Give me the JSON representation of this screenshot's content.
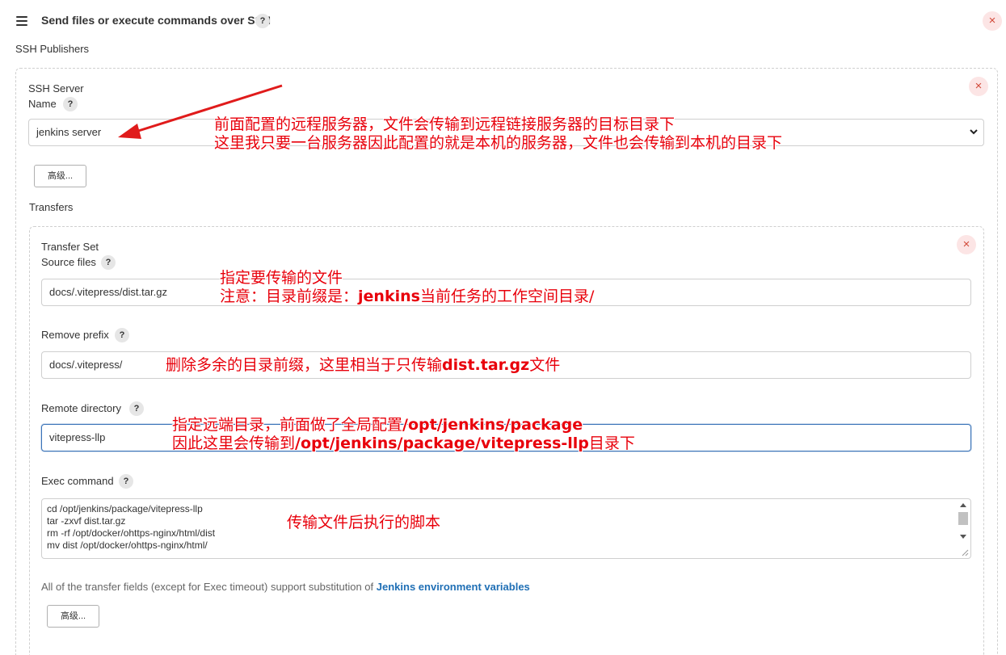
{
  "header": {
    "title": "Send files or execute commands over SSH",
    "help": "?",
    "close": "×",
    "publishers_label": "SSH Publishers"
  },
  "server": {
    "heading": "SSH Server",
    "name_label": "Name",
    "help": "?",
    "close": "×",
    "name_value": "jenkins server",
    "advanced_button": "高级...",
    "transfers_label": "Transfers"
  },
  "transfer_set": {
    "heading": "Transfer Set",
    "close": "×",
    "source_files": {
      "label": "Source files",
      "help": "?",
      "value": "docs/.vitepress/dist.tar.gz"
    },
    "remove_prefix": {
      "label": "Remove prefix",
      "help": "?",
      "value": "docs/.vitepress/"
    },
    "remote_directory": {
      "label": "Remote directory",
      "help": "?",
      "value": "vitepress-llp"
    },
    "exec_command": {
      "label": "Exec command",
      "help": "?",
      "lines": [
        "cd /opt/jenkins/package/vitepress-llp",
        "tar -zxvf dist.tar.gz",
        "rm -rf /opt/docker/ohttps-nginx/html/dist",
        "mv dist /opt/docker/ohttps-nginx/html/"
      ]
    },
    "note_text": "All of the transfer fields (except for Exec timeout) support substitution of",
    "note_link": "Jenkins environment variables",
    "advanced_button": "高级..."
  },
  "annotations": {
    "server_line1": "前面配置的远程服务器，文件会传输到远程链接服务器的目标目录下",
    "server_line2": "这里我只要一台服务器因此配置的就是本机的服务器，文件也会传输到本机的目录下",
    "source_line1": "指定要传输的文件",
    "source_line2a": "注意：目录前缀是：",
    "source_line2b": "jenkins",
    "source_line2c": "当前任务的工作空间目录/",
    "prefix_a": "删除多余的目录前缀，这里相当于只传输",
    "prefix_b": "dist.tar.gz",
    "prefix_c": "文件",
    "remote_line1a": "指定远端目录，前面做了全局配置",
    "remote_line1b": "/opt/jenkins/package",
    "remote_line2a": "因此这里会传输到",
    "remote_line2b": "/opt/jenkins/package/vitepress-llp",
    "remote_line2c": "目录下",
    "exec": "传输文件后执行的脚本"
  },
  "colors": {
    "annotation": "#e8000b",
    "arrow": "#e01b1b",
    "link": "#1f6fb5",
    "close_bg": "#fce5e5",
    "close_fg": "#d24939"
  }
}
